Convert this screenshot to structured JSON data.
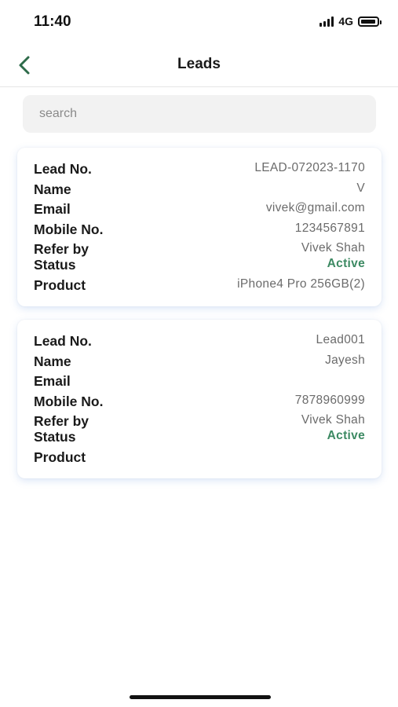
{
  "status_bar": {
    "time": "11:40",
    "network": "4G"
  },
  "nav": {
    "title": "Leads",
    "back_icon": "chevron-left-icon",
    "accent_color": "#2e6b4a"
  },
  "search": {
    "placeholder": "search",
    "value": ""
  },
  "labels": {
    "lead_no": "Lead No.",
    "name": "Name",
    "email": "Email",
    "mobile": "Mobile No.",
    "refer_by": "Refer by",
    "status": "Status",
    "product": "Product"
  },
  "leads": [
    {
      "lead_no": "LEAD-072023-1170",
      "name": "V",
      "email": "vivek@gmail.com",
      "mobile": "1234567891",
      "refer_by": "Vivek Shah",
      "status": "Active",
      "product": "iPhone4 Pro 256GB(2)"
    },
    {
      "lead_no": "Lead001",
      "name": "Jayesh",
      "email": "",
      "mobile": "7878960999",
      "refer_by": "Vivek Shah",
      "status": "Active",
      "product": ""
    }
  ],
  "colors": {
    "status_active": "#3d8a63"
  }
}
